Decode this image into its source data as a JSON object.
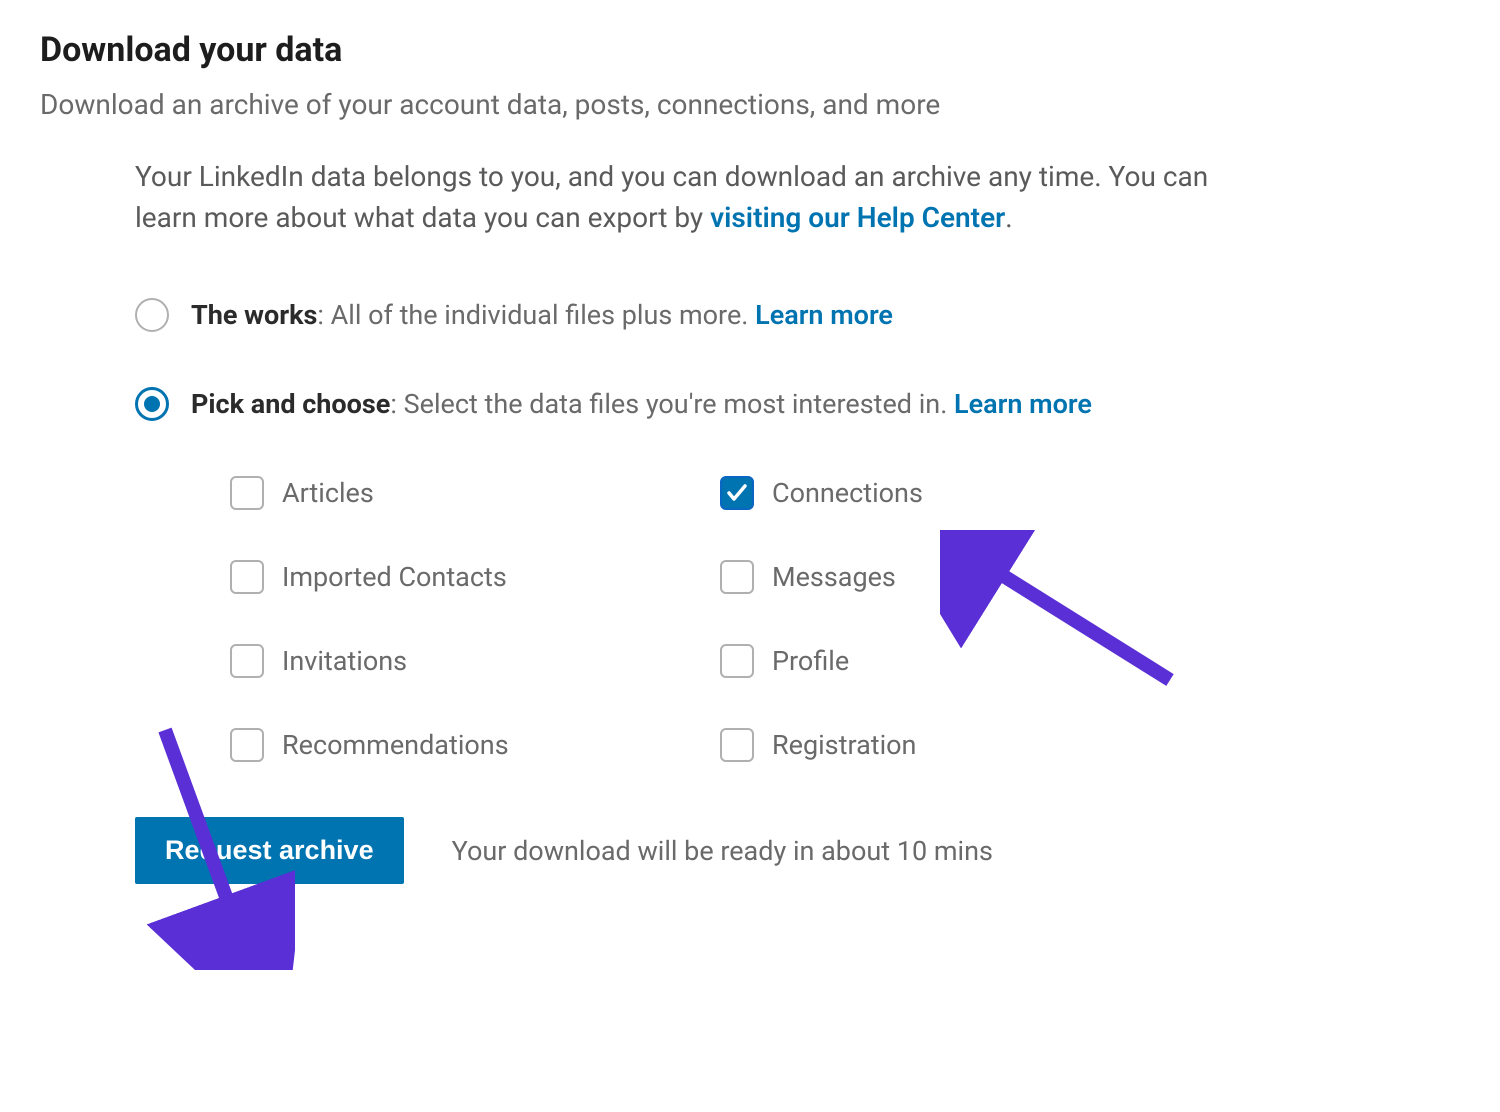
{
  "header": {
    "title": "Download your data",
    "subtitle": "Download an archive of your account data, posts, connections, and more"
  },
  "intro": {
    "text_before_link": "Your LinkedIn data belongs to you, and you can download an archive any time. You can learn more about what data you can export by ",
    "link_text": "visiting our Help Center",
    "text_after_link": "."
  },
  "options": {
    "works": {
      "label_strong": "The works",
      "label_rest": ": All of the individual files plus more. ",
      "learn_more": "Learn more",
      "selected": false
    },
    "pick": {
      "label_strong": "Pick and choose",
      "label_rest": ": Select the data files you're most interested in. ",
      "learn_more": "Learn more",
      "selected": true
    }
  },
  "checkboxes": {
    "articles": {
      "label": "Articles",
      "checked": false
    },
    "connections": {
      "label": "Connections",
      "checked": true
    },
    "imported_contacts": {
      "label": "Imported Contacts",
      "checked": false
    },
    "messages": {
      "label": "Messages",
      "checked": false
    },
    "invitations": {
      "label": "Invitations",
      "checked": false
    },
    "profile": {
      "label": "Profile",
      "checked": false
    },
    "recommendations": {
      "label": "Recommendations",
      "checked": false
    },
    "registration": {
      "label": "Registration",
      "checked": false
    }
  },
  "action": {
    "button_label": "Request archive",
    "ready_text": "Your download will be ready in about 10 mins"
  },
  "colors": {
    "accent": "#0073b1",
    "annotation_arrow": "#5a2fd6"
  }
}
